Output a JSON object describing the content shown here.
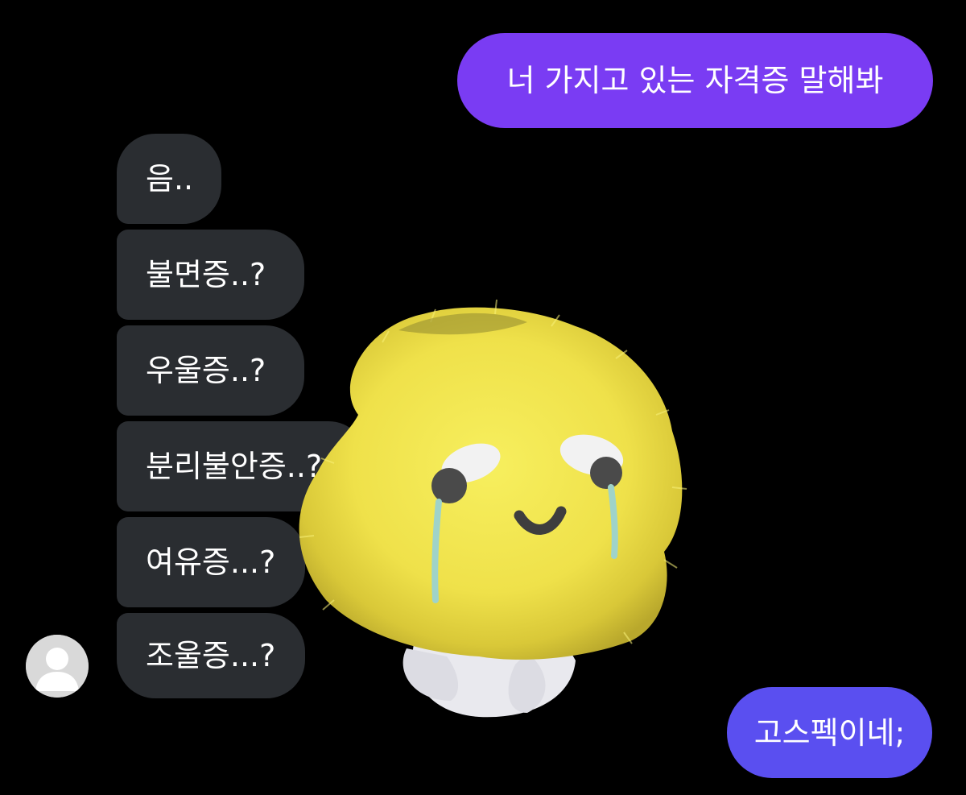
{
  "messages": {
    "outgoing": [
      {
        "text": "너 가지고 있는 자격증 말해봐",
        "color": "#7a3cf3"
      },
      {
        "text": "고스펙이네;",
        "color": "#5a4ff0"
      }
    ],
    "incoming": [
      {
        "text": "음.."
      },
      {
        "text": "불면증..?"
      },
      {
        "text": "우울증..?"
      },
      {
        "text": "분리불안증..?"
      },
      {
        "text": "여유증...?"
      },
      {
        "text": "조울증...?"
      }
    ],
    "incoming_color": "#2a2d31"
  },
  "avatar": {
    "icon": "default-user-avatar-icon"
  },
  "sticker": {
    "icon": "crying-yellow-plush-sticker"
  }
}
